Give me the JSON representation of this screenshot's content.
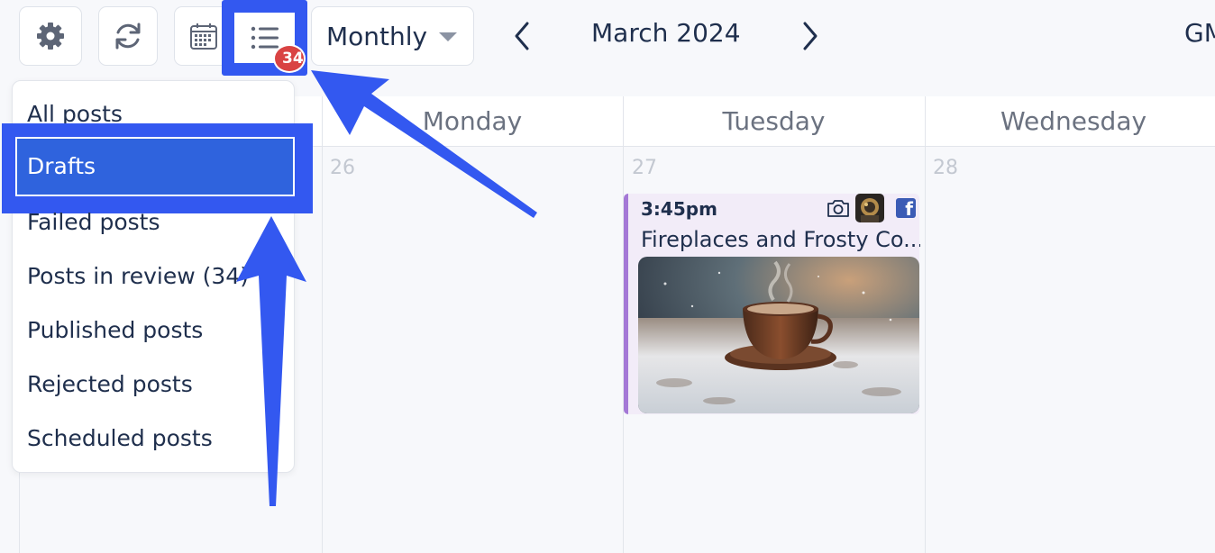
{
  "toolbar": {
    "settings_icon": "gear-icon",
    "refresh_icon": "refresh-icon",
    "calendar_icon": "calendar-icon",
    "list_icon": "list-icon",
    "list_badge": "34",
    "view_mode": "Monthly",
    "month_label": "March 2024",
    "timezone_label": "GMT"
  },
  "columns": [
    {
      "day": "Monday",
      "date": "26"
    },
    {
      "day": "Tuesday",
      "date": "27"
    },
    {
      "day": "Wednesday",
      "date": "28"
    }
  ],
  "event": {
    "time": "3:45pm",
    "title": "Fireplaces and Frosty Co...",
    "accent_color": "#a478d6",
    "network": "Facebook",
    "media_icon": "camera-icon"
  },
  "dropdown": {
    "items": [
      {
        "label": "All posts"
      },
      {
        "label": "Drafts",
        "selected": true
      },
      {
        "label": "Failed posts"
      },
      {
        "label": "Posts in review (34)"
      },
      {
        "label": "Published posts"
      },
      {
        "label": "Rejected posts"
      },
      {
        "label": "Scheduled posts"
      }
    ]
  },
  "colors": {
    "highlight": "#3358f0",
    "badge": "#d94343",
    "text": "#1f2f4d"
  }
}
